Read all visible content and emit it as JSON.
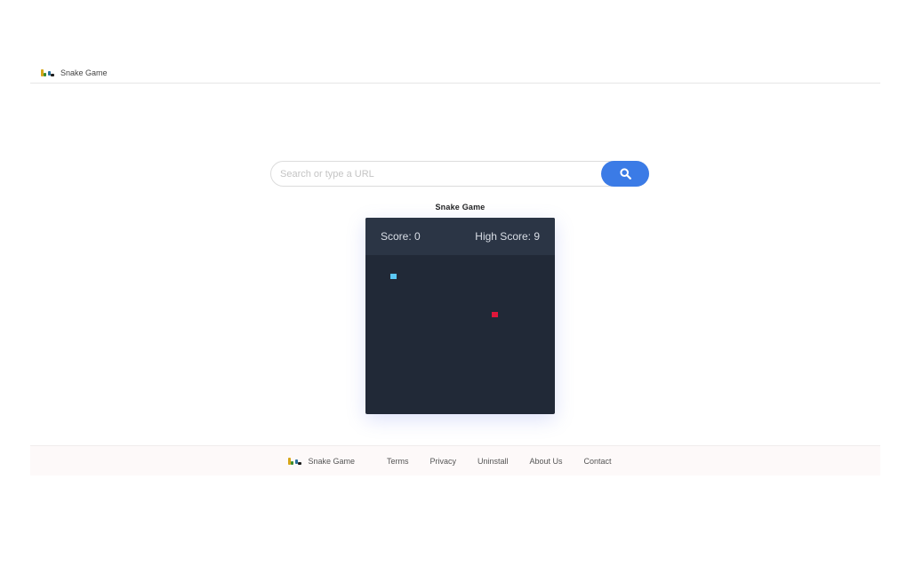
{
  "header": {
    "brand": "Snake Game"
  },
  "search": {
    "placeholder": "Search or type a URL"
  },
  "game": {
    "title": "Snake Game",
    "score_label": "Score: 0",
    "high_score_label": "High Score: 9",
    "score": 0,
    "high_score": 9,
    "grid": {
      "cols": 30,
      "rows": 25
    },
    "snake": [
      {
        "col": 4,
        "row": 3
      }
    ],
    "food": {
      "col": 20,
      "row": 9
    },
    "colors": {
      "snake": "#5bc8f5",
      "food": "#e0163a",
      "board": "#212937",
      "header": "#2b3545"
    }
  },
  "footer": {
    "brand": "Snake Game",
    "links": [
      "Terms",
      "Privacy",
      "Uninstall",
      "About Us",
      "Contact"
    ]
  },
  "colors": {
    "accent": "#3b7be6"
  }
}
